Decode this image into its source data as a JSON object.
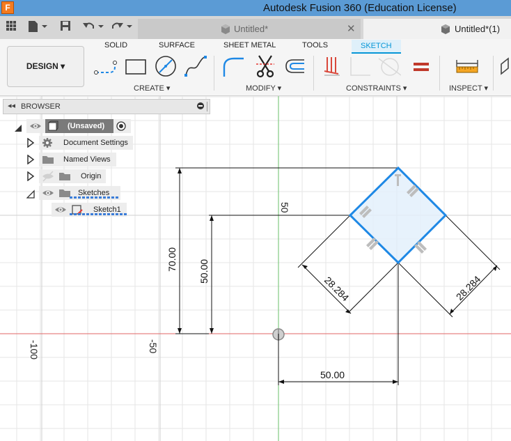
{
  "window": {
    "title": "Autodesk Fusion 360 (Education License)",
    "app_icon": "F"
  },
  "tabs": [
    {
      "label": "Untitled*"
    },
    {
      "label": "Untitled*(1)"
    }
  ],
  "ribbon": {
    "workspace": "DESIGN",
    "tabs": [
      "SOLID",
      "SURFACE",
      "SHEET METAL",
      "TOOLS",
      "SKETCH"
    ],
    "active_tab": "SKETCH",
    "groups": [
      "CREATE",
      "MODIFY",
      "CONSTRAINTS",
      "INSPECT"
    ]
  },
  "browser": {
    "title": "BROWSER",
    "root": "(Unsaved)",
    "items": [
      "Document Settings",
      "Named Views",
      "Origin",
      "Sketches",
      "Sketch1"
    ]
  },
  "sketch": {
    "dim_total_height": "70.00",
    "dim_inner_height": "50.00",
    "dim_side_left": "28.284",
    "dim_side_right": "28.284",
    "dim_horizontal": "50.00",
    "axis_labels": [
      "-100",
      "-50",
      "50"
    ]
  },
  "colors": {
    "title_bar": "#5b9bd5",
    "accent": "#0696d7",
    "sketch_line": "#1e88e5",
    "x_axis": "#e06666",
    "y_axis": "#6abf69"
  }
}
